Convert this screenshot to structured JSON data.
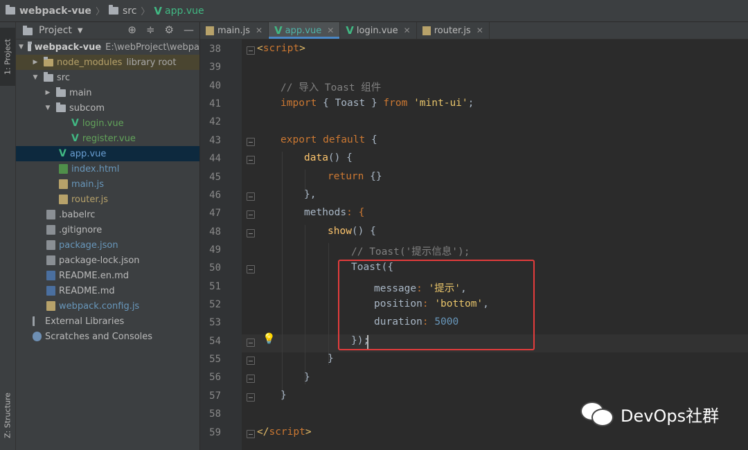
{
  "breadcrumb": {
    "project": "webpack-vue",
    "folder": "src",
    "file": "app.vue"
  },
  "toolstrip": {
    "project_tab": "1: Project",
    "structure_tab": "Z: Structure"
  },
  "project_panel": {
    "title": "Project",
    "tree": [
      {
        "label": "webpack-vue",
        "extra": "E:\\webProject\\webpa",
        "kind": "root"
      },
      {
        "label": "node_modules",
        "extra": "library root",
        "kind": "dir"
      },
      {
        "label": "src",
        "kind": "dir"
      },
      {
        "label": "main",
        "kind": "dir"
      },
      {
        "label": "subcom",
        "kind": "dir"
      },
      {
        "label": "login.vue",
        "kind": "vue"
      },
      {
        "label": "register.vue",
        "kind": "vue"
      },
      {
        "label": "app.vue",
        "kind": "vue"
      },
      {
        "label": "index.html",
        "kind": "html"
      },
      {
        "label": "main.js",
        "kind": "js"
      },
      {
        "label": "router.js",
        "kind": "js"
      },
      {
        "label": ".babelrc",
        "kind": "file"
      },
      {
        "label": ".gitignore",
        "kind": "file"
      },
      {
        "label": "package.json",
        "kind": "json"
      },
      {
        "label": "package-lock.json",
        "kind": "json"
      },
      {
        "label": "README.en.md",
        "kind": "md"
      },
      {
        "label": "README.md",
        "kind": "md"
      },
      {
        "label": "webpack.config.js",
        "kind": "js"
      },
      {
        "label": "External Libraries",
        "kind": "lib"
      },
      {
        "label": "Scratches and Consoles",
        "kind": "scratch"
      }
    ]
  },
  "tabs": [
    {
      "label": "main.js",
      "active": false
    },
    {
      "label": "app.vue",
      "active": true
    },
    {
      "label": "login.vue",
      "active": false
    },
    {
      "label": "router.js",
      "active": false
    }
  ],
  "editor": {
    "line_numbers": [
      "38",
      "39",
      "40",
      "41",
      "42",
      "43",
      "44",
      "45",
      "46",
      "47",
      "48",
      "49",
      "50",
      "51",
      "52",
      "53",
      "54",
      "55",
      "56",
      "57",
      "58",
      "59"
    ],
    "code": {
      "l38_open": "<",
      "l38_tag": "script",
      "l38_close": ">",
      "l40_comment": "// 导入 Toast 组件",
      "l41_import": "import",
      "l41_mid": " { Toast } ",
      "l41_from": "from",
      "l41_str": "'mint-ui'",
      "l41_end": ";",
      "l43_export": "export default",
      "l43_end": " {",
      "l44_fn": "data",
      "l44_end": "() {",
      "l45_return": "return",
      "l45_end": " {}",
      "l46": "},",
      "l47_prop": "methods",
      "l47_end": ": {",
      "l48_fn": "show",
      "l48_end": "() {",
      "l49_comment": "// Toast('提示信息');",
      "l50": "Toast({",
      "l51_key": "message",
      "l51_sep": ": ",
      "l51_val": "'提示'",
      "l51_end": ",",
      "l52_key": "position",
      "l52_sep": ": ",
      "l52_val": "'bottom'",
      "l52_end": ",",
      "l53_key": "duration",
      "l53_sep": ": ",
      "l53_val": "5000",
      "l54": "});",
      "l55": "}",
      "l56": "}",
      "l57": "}",
      "l59_open": "</",
      "l59_tag": "script",
      "l59_close": ">"
    }
  },
  "watermark": {
    "text": "DevOps社群"
  },
  "colors": {
    "keyword": "#cc7832",
    "string": "#6a8759",
    "number": "#6897bb",
    "comment": "#808080",
    "highlight_box": "#e43c3c"
  }
}
